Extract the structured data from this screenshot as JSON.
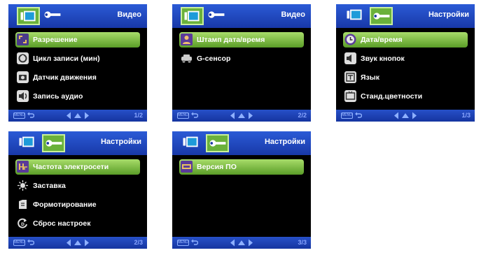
{
  "footer": {
    "menu_label": "MENU"
  },
  "screens": [
    {
      "header": {
        "title": "Видео"
      },
      "page": "1/2",
      "items": [
        {
          "label": "Разрешение",
          "icon": "resolution-icon"
        },
        {
          "label": "Цикл записи (мин)",
          "icon": "loop-record-icon"
        },
        {
          "label": "Датчик движения",
          "icon": "motion-sensor-icon"
        },
        {
          "label": "Запись аудио",
          "icon": "audio-record-icon"
        }
      ]
    },
    {
      "header": {
        "title": "Видео"
      },
      "page": "2/2",
      "items": [
        {
          "label": "Штамп дата/время",
          "icon": "date-stamp-icon"
        },
        {
          "label": "G-сенсор",
          "icon": "g-sensor-icon"
        }
      ]
    },
    {
      "header": {
        "title": "Настройки"
      },
      "page": "1/3",
      "items": [
        {
          "label": "Дата/время",
          "icon": "clock-icon"
        },
        {
          "label": "Звук кнопок",
          "icon": "speaker-icon"
        },
        {
          "label": "Язык",
          "icon": "language-icon"
        },
        {
          "label": "Станд.цветности",
          "icon": "tv-standard-icon"
        }
      ]
    },
    {
      "header": {
        "title": "Настройки"
      },
      "page": "2/3",
      "items": [
        {
          "label": "Частота электросети",
          "icon": "frequency-icon"
        },
        {
          "label": "Заставка",
          "icon": "screensaver-icon"
        },
        {
          "label": "Формотирование",
          "icon": "format-icon"
        },
        {
          "label": "Сброс настроек",
          "icon": "reset-icon"
        }
      ]
    },
    {
      "header": {
        "title": "Настройки"
      },
      "page": "3/3",
      "items": [
        {
          "label": "Версия ПО",
          "icon": "firmware-version-icon"
        }
      ]
    }
  ]
}
